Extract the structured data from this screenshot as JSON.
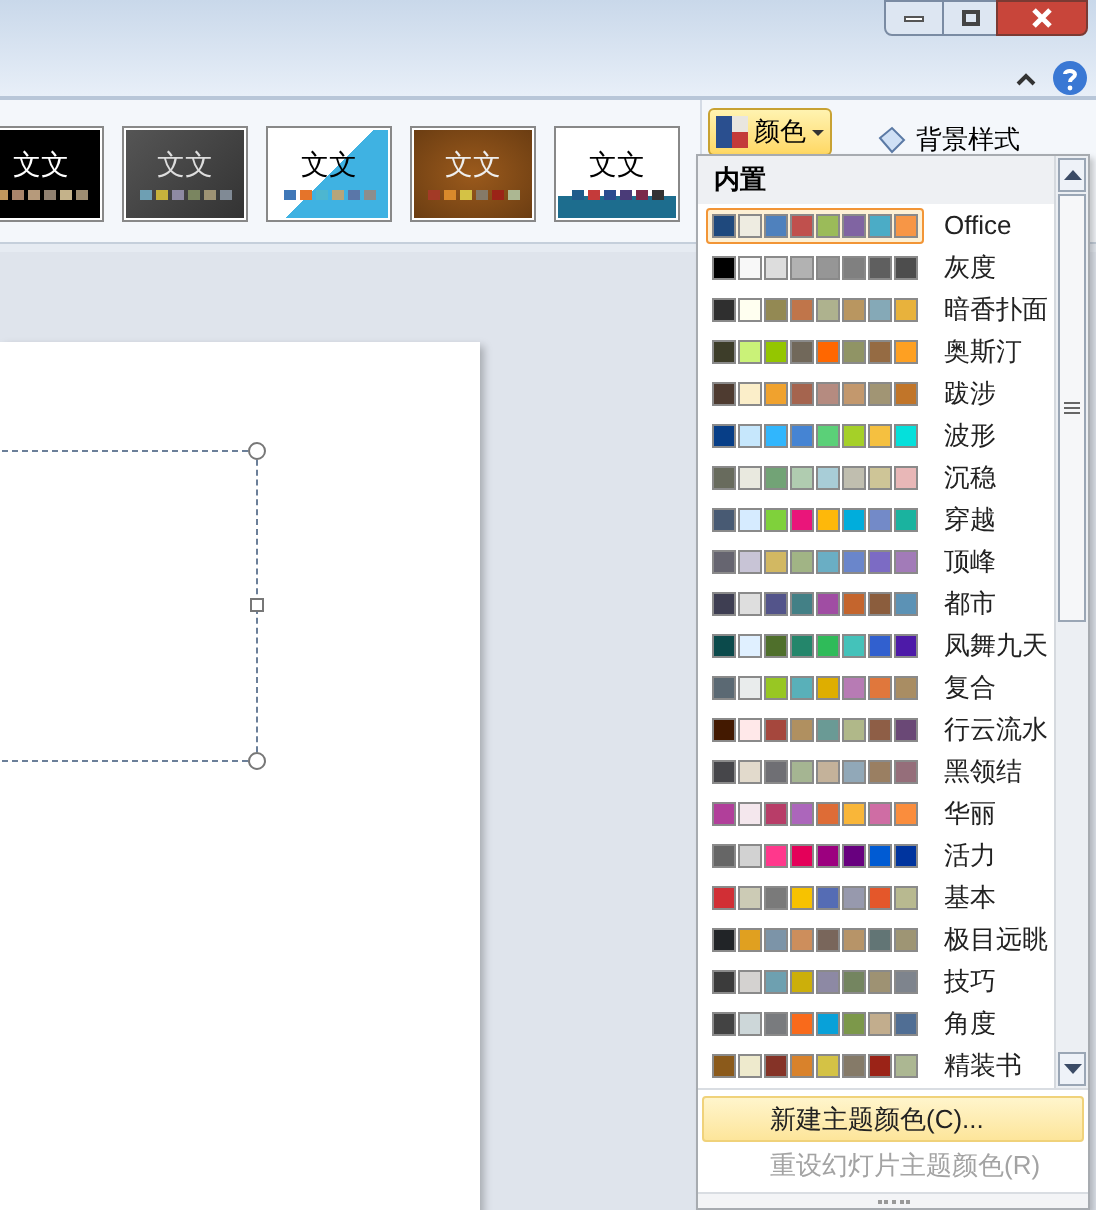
{
  "ribbon": {
    "theme_gallery": [
      {
        "kind": "dark",
        "label": "文文"
      },
      {
        "kind": "gray",
        "label": "文文"
      },
      {
        "kind": "blue",
        "label": "文文"
      },
      {
        "kind": "brown",
        "label": "文文"
      },
      {
        "kind": "light",
        "label": "文文"
      }
    ],
    "colors_button": {
      "label": "颜色",
      "selected": true
    },
    "background_styles": {
      "label": "背景样式"
    }
  },
  "color_menu": {
    "section": "内置",
    "schemes": [
      {
        "name": "Office",
        "selected": true,
        "swatches": [
          {
            "color": "#1f497d"
          },
          {
            "color": "#eeece1"
          },
          {
            "color": "#4f81bd"
          },
          {
            "color": "#c0504d"
          },
          {
            "color": "#9bbb59"
          },
          {
            "color": "#8064a2"
          },
          {
            "color": "#4bacc6"
          },
          {
            "color": "#f79646"
          }
        ]
      },
      {
        "name": "灰度",
        "selected": false,
        "swatches": [
          {
            "color": "#000000"
          },
          {
            "color": "#f8f8f8"
          },
          {
            "color": "#dddddd"
          },
          {
            "color": "#b2b2b2"
          },
          {
            "color": "#969696"
          },
          {
            "color": "#808080"
          },
          {
            "color": "#5f5f5f"
          },
          {
            "color": "#4d4d4d"
          }
        ]
      },
      {
        "name": "暗香扑面",
        "selected": false,
        "swatches": [
          {
            "color": "#2f2f2f"
          },
          {
            "color": "#fffff0"
          },
          {
            "color": "#938953"
          },
          {
            "color": "#c0754a"
          },
          {
            "color": "#aeb28e"
          },
          {
            "color": "#b99660"
          },
          {
            "color": "#85a9b7"
          },
          {
            "color": "#e8b23c"
          }
        ]
      },
      {
        "name": "奥斯汀",
        "selected": false,
        "swatches": [
          {
            "color": "#3d3d29"
          },
          {
            "color": "#caf278"
          },
          {
            "color": "#94c600"
          },
          {
            "color": "#71685a"
          },
          {
            "color": "#ff6700"
          },
          {
            "color": "#909465"
          },
          {
            "color": "#956b43"
          },
          {
            "color": "#fea022"
          }
        ]
      },
      {
        "name": "跋涉",
        "selected": false,
        "swatches": [
          {
            "color": "#4e3b30"
          },
          {
            "color": "#fbeec9"
          },
          {
            "color": "#f0a22e"
          },
          {
            "color": "#a5644e"
          },
          {
            "color": "#b58b80"
          },
          {
            "color": "#c3986d"
          },
          {
            "color": "#a19574"
          },
          {
            "color": "#c17529"
          }
        ]
      },
      {
        "name": "波形",
        "selected": false,
        "swatches": [
          {
            "color": "#073e87"
          },
          {
            "color": "#c6e7fc"
          },
          {
            "color": "#31b6fd"
          },
          {
            "color": "#4584d3"
          },
          {
            "color": "#5bd078"
          },
          {
            "color": "#a5d028"
          },
          {
            "color": "#f5c040"
          },
          {
            "color": "#05e0db"
          }
        ]
      },
      {
        "name": "沉稳",
        "selected": false,
        "swatches": [
          {
            "color": "#686b5d"
          },
          {
            "color": "#e9e9df"
          },
          {
            "color": "#72a376"
          },
          {
            "color": "#b0ccb0"
          },
          {
            "color": "#a8cdd7"
          },
          {
            "color": "#c0beaf"
          },
          {
            "color": "#cec597"
          },
          {
            "color": "#e8b7b7"
          }
        ]
      },
      {
        "name": "穿越",
        "selected": false,
        "swatches": [
          {
            "color": "#485a73"
          },
          {
            "color": "#d6ebff"
          },
          {
            "color": "#7fd13b"
          },
          {
            "color": "#ea157a"
          },
          {
            "color": "#feb80a"
          },
          {
            "color": "#00addc"
          },
          {
            "color": "#738ac8"
          },
          {
            "color": "#1ab39f"
          }
        ]
      },
      {
        "name": "顶峰",
        "selected": false,
        "swatches": [
          {
            "color": "#666570"
          },
          {
            "color": "#c8c4d6"
          },
          {
            "color": "#d2b862"
          },
          {
            "color": "#a1b485"
          },
          {
            "color": "#6aaec4"
          },
          {
            "color": "#6a86cb"
          },
          {
            "color": "#7c6bc4"
          },
          {
            "color": "#a27bb8"
          }
        ]
      },
      {
        "name": "都市",
        "selected": false,
        "swatches": [
          {
            "color": "#3e3e52"
          },
          {
            "color": "#dedede"
          },
          {
            "color": "#53548a"
          },
          {
            "color": "#438086"
          },
          {
            "color": "#a04da3"
          },
          {
            "color": "#c4652d"
          },
          {
            "color": "#8b5d3d"
          },
          {
            "color": "#5c92b5"
          }
        ]
      },
      {
        "name": "凤舞九天",
        "selected": false,
        "swatches": [
          {
            "color": "#0b4a4b"
          },
          {
            "color": "#e0f0ff"
          },
          {
            "color": "#4f6f2b"
          },
          {
            "color": "#24866b"
          },
          {
            "color": "#2fbb59"
          },
          {
            "color": "#44c2ba"
          },
          {
            "color": "#3160cf"
          },
          {
            "color": "#4d1aa8"
          }
        ]
      },
      {
        "name": "复合",
        "selected": false,
        "swatches": [
          {
            "color": "#5b6973"
          },
          {
            "color": "#e9ecec"
          },
          {
            "color": "#98c723"
          },
          {
            "color": "#59b0b9"
          },
          {
            "color": "#deae00"
          },
          {
            "color": "#b77bb4"
          },
          {
            "color": "#e0773c"
          },
          {
            "color": "#a98d63"
          }
        ]
      },
      {
        "name": "行云流水",
        "selected": false,
        "swatches": [
          {
            "color": "#431900"
          },
          {
            "color": "#ffe8e9"
          },
          {
            "color": "#a5473d"
          },
          {
            "color": "#b09060"
          },
          {
            "color": "#6a9a95"
          },
          {
            "color": "#b0b889"
          },
          {
            "color": "#8e5e46"
          },
          {
            "color": "#6a4876"
          }
        ]
      },
      {
        "name": "黑领结",
        "selected": false,
        "swatches": [
          {
            "color": "#46464a"
          },
          {
            "color": "#e2dacc"
          },
          {
            "color": "#6f6f74"
          },
          {
            "color": "#a5b592"
          },
          {
            "color": "#c4b29a"
          },
          {
            "color": "#91a8b8"
          },
          {
            "color": "#9a7f62"
          },
          {
            "color": "#956e7a"
          }
        ]
      },
      {
        "name": "华丽",
        "selected": false,
        "swatches": [
          {
            "color": "#b13f9a"
          },
          {
            "color": "#f4e7ed"
          },
          {
            "color": "#b83d68"
          },
          {
            "color": "#ac66bb"
          },
          {
            "color": "#de6c36"
          },
          {
            "color": "#f9b639"
          },
          {
            "color": "#cf6da4"
          },
          {
            "color": "#fa8d3d"
          }
        ]
      },
      {
        "name": "活力",
        "selected": false,
        "swatches": [
          {
            "color": "#666666"
          },
          {
            "color": "#d2d2d2"
          },
          {
            "color": "#ff388c"
          },
          {
            "color": "#e40059"
          },
          {
            "color": "#9c007f"
          },
          {
            "color": "#68007f"
          },
          {
            "color": "#005bd3"
          },
          {
            "color": "#00349e"
          }
        ]
      },
      {
        "name": "基本",
        "selected": false,
        "swatches": [
          {
            "color": "#d12f35"
          },
          {
            "color": "#cccbb5"
          },
          {
            "color": "#7a7a7a"
          },
          {
            "color": "#f7c200"
          },
          {
            "color": "#556cb4"
          },
          {
            "color": "#9799ad"
          },
          {
            "color": "#e4572a"
          },
          {
            "color": "#b8b990"
          }
        ]
      },
      {
        "name": "极目远眺",
        "selected": false,
        "swatches": [
          {
            "color": "#212427"
          },
          {
            "color": "#e0a020"
          },
          {
            "color": "#7c94a8"
          },
          {
            "color": "#cd8e5c"
          },
          {
            "color": "#79665b"
          },
          {
            "color": "#b79468"
          },
          {
            "color": "#627575"
          },
          {
            "color": "#9e9574"
          }
        ]
      },
      {
        "name": "技巧",
        "selected": false,
        "swatches": [
          {
            "color": "#3b3b3b"
          },
          {
            "color": "#d4d2d0"
          },
          {
            "color": "#6ea0b0"
          },
          {
            "color": "#ccaf0a"
          },
          {
            "color": "#8d89a4"
          },
          {
            "color": "#748560"
          },
          {
            "color": "#9e9273"
          },
          {
            "color": "#7e848d"
          }
        ]
      },
      {
        "name": "角度",
        "selected": false,
        "swatches": [
          {
            "color": "#434343"
          },
          {
            "color": "#cdd7d9"
          },
          {
            "color": "#797b7e"
          },
          {
            "color": "#f96a1b"
          },
          {
            "color": "#08a1d9"
          },
          {
            "color": "#7c984a"
          },
          {
            "color": "#c2ad8d"
          },
          {
            "color": "#506e94"
          }
        ]
      },
      {
        "name": "精装书",
        "selected": false,
        "swatches": [
          {
            "color": "#8b5a1b"
          },
          {
            "color": "#eeeacd"
          },
          {
            "color": "#853327"
          },
          {
            "color": "#d9822b"
          },
          {
            "color": "#d4c245"
          },
          {
            "color": "#857a68"
          },
          {
            "color": "#9b2317"
          },
          {
            "color": "#acb792"
          }
        ]
      }
    ],
    "commands": [
      {
        "label": "新建主题颜色(C)...",
        "selected": true,
        "disabled": false
      },
      {
        "label": "重设幻灯片主题颜色(R)",
        "selected": false,
        "disabled": true
      }
    ]
  }
}
